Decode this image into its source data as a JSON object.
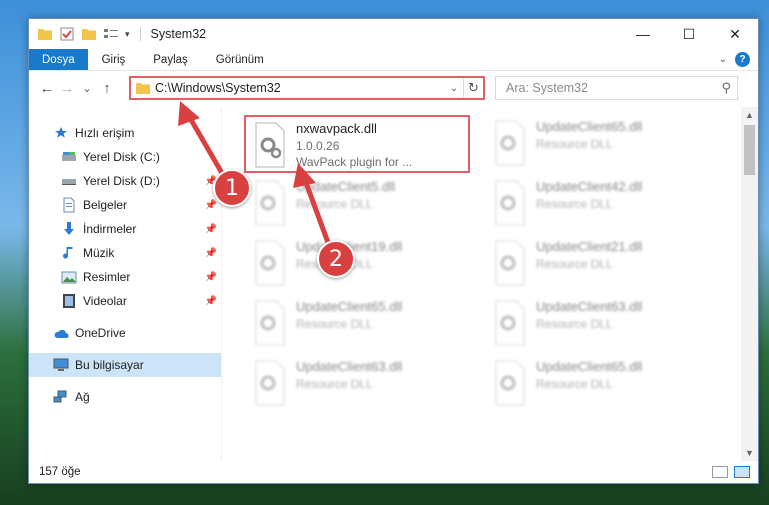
{
  "window": {
    "title": "System32",
    "controls": {
      "minimize": "—",
      "maximize": "☐",
      "close": "✕"
    }
  },
  "ribbon": {
    "tabs": [
      "Dosya",
      "Giriş",
      "Paylaş",
      "Görünüm"
    ]
  },
  "nav": {
    "back": "←",
    "forward": "→",
    "recent": "⌄",
    "up": "↑",
    "address": "C:\\Windows\\System32",
    "search_placeholder": "Ara: System32"
  },
  "sidebar": {
    "quick_access": "Hızlı erişim",
    "items": [
      {
        "label": "Yerel Disk (C:)",
        "icon": "drive-icon"
      },
      {
        "label": "Yerel Disk (D:)",
        "icon": "drive-icon"
      },
      {
        "label": "Belgeler",
        "icon": "documents-icon"
      },
      {
        "label": "İndirmeler",
        "icon": "downloads-icon"
      },
      {
        "label": "Müzik",
        "icon": "music-icon"
      },
      {
        "label": "Resimler",
        "icon": "pictures-icon"
      },
      {
        "label": "Videolar",
        "icon": "videos-icon"
      }
    ],
    "onedrive": "OneDrive",
    "this_pc": "Bu bilgisayar",
    "network": "Ağ"
  },
  "files": {
    "highlighted": {
      "name": "nxwavpack.dll",
      "version": "1.0.0.26",
      "description": "WavPack plugin for ..."
    },
    "blurred": [
      {
        "name": "UpdateClient65.dll",
        "type": "Resource DLL"
      },
      {
        "name": "UpdateClient5.dll",
        "type": "Resource DLL"
      },
      {
        "name": "UpdateClient42.dll",
        "type": "Resource DLL"
      },
      {
        "name": "UpdateClient19.dll",
        "type": "Resource DLL"
      },
      {
        "name": "UpdateClient21.dll",
        "type": "Resource DLL"
      },
      {
        "name": "UpdateClient65.dll",
        "type": "Resource DLL"
      },
      {
        "name": "UpdateClient63.dll",
        "type": "Resource DLL"
      },
      {
        "name": "UpdateClient63.dll",
        "type": "Resource DLL"
      },
      {
        "name": "UpdateClient65.dll",
        "type": "Resource DLL"
      }
    ]
  },
  "status": {
    "count": "157 öğe"
  },
  "annotations": {
    "step1": "1",
    "step2": "2",
    "color": "#d94040"
  }
}
